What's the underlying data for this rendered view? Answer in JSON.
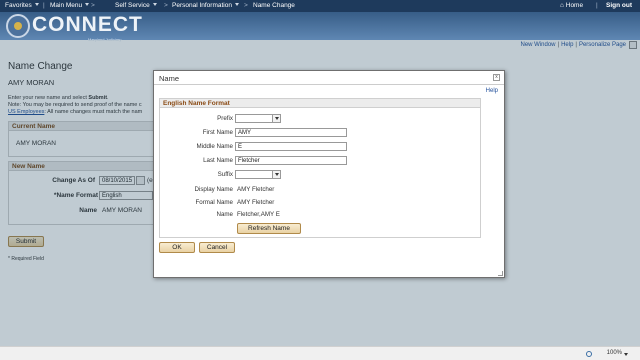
{
  "topnav": {
    "favorites": "Favorites",
    "main_menu": "Main Menu",
    "self_service": "Self Service",
    "personal_information": "Personal Information",
    "name_change": "Name Change",
    "home": "Home",
    "sign_out": "Sign out"
  },
  "banner": {
    "logo": "CONNECT",
    "subtitle": "Maryland Judiciary"
  },
  "utility": {
    "new_window": "New Window",
    "help": "Help",
    "personalize": "Personalize Page"
  },
  "page": {
    "title": "Name Change",
    "person": "AMY MORAN",
    "instr1_pre": "Enter your new name and select ",
    "instr1_bold": "Submit",
    "instr2": "Note: You may be required to send proof of the name c",
    "instr3_link": "US Employees",
    "instr3_rest": ": All name changes must match the nam",
    "current_name_hdr": "Current Name",
    "current_name": "AMY MORAN",
    "new_name_hdr": "New Name",
    "change_as_of_label": "Change As Of",
    "change_as_of_value": "08/10/2015",
    "change_as_of_hint": "(e",
    "name_format_label": "*Name Format",
    "name_format_value": "English",
    "name_label": "Name",
    "name_value": "AMY MORAN",
    "submit": "Submit",
    "required": "* Required Field"
  },
  "modal": {
    "title": "Name",
    "close": "x",
    "help": "Help",
    "section_header": "English Name Format",
    "prefix_label": "Prefix",
    "prefix_value": "",
    "first_name_label": "First Name",
    "first_name_value": "AMY",
    "middle_name_label": "Middle Name",
    "middle_name_value": "E",
    "last_name_label": "Last Name",
    "last_name_value": "Fletcher",
    "suffix_label": "Suffix",
    "suffix_value": "",
    "display_name_label": "Display Name",
    "display_name_value": "AMY Fletcher",
    "formal_name_label": "Formal Name",
    "formal_name_value": "AMY Fletcher",
    "name_label": "Name",
    "name_value": "Fletcher,AMY E",
    "refresh_button": "Refresh Name",
    "ok_button": "OK",
    "cancel_button": "Cancel"
  },
  "statusbar": {
    "zoom": "100%"
  },
  "colors": {
    "nav_bg": "#1e3a5c",
    "banner": "#4a709b",
    "section_header_text": "#8a4a14",
    "link": "#1f4e9a",
    "button": "#f0dcb4"
  },
  "icons": [
    "home-icon",
    "dropdown-caret-icon",
    "logo-icon",
    "close-icon",
    "zoom-icon",
    "resize-grip-icon"
  ]
}
